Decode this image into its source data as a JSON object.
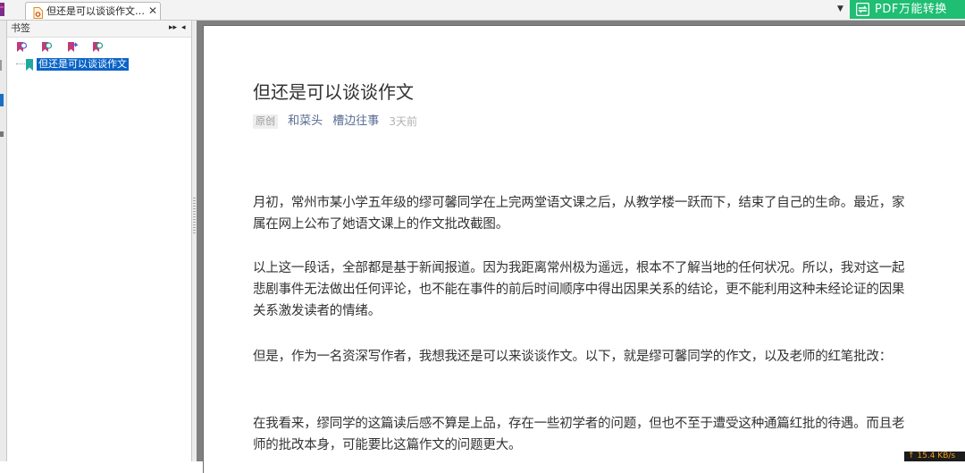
{
  "tab_bar": {
    "tab_title": "但还是可以谈谈作文....",
    "close_glyph": "✕",
    "dropdown_glyph": "▼",
    "pdf_button_label": "PDF万能转换",
    "pdf_button_color": "#1fbe73"
  },
  "bookmark_panel": {
    "title": "书签",
    "pin_glyph": "▸▸",
    "collapse_glyph": "◂",
    "toolbar_icons": [
      "add-bookmark-icon",
      "expand-bookmark-icon",
      "bookmark-forward-icon",
      "find-bookmark-icon"
    ],
    "item": {
      "label": "但还是可以谈谈作文",
      "icon": "bookmark-icon"
    }
  },
  "article": {
    "title": "但还是可以谈谈作文",
    "tag": "原创",
    "author": "和菜头",
    "account": "槽边往事",
    "time": "3天前",
    "paragraphs": [
      "月初，常州市某小学五年级的缪可馨同学在上完两堂语文课之后，从教学楼一跃而下，结束了自己的生命。最近，家属在网上公布了她语文课上的作文批改截图。",
      "以上这一段话，全部都是基于新闻报道。因为我距离常州极为遥远，根本不了解当地的任何状况。所以，我对这一起悲剧事件无法做出任何评论，也不能在事件的前后时间顺序中得出因果关系的结论，更不能利用这种未经论证的因果关系激发读者的情绪。",
      "但是，作为一名资深写作者，我想我还是可以来谈谈作文。以下，就是缪可馨同学的作文，以及老师的红笔批改：",
      "在我看来，缪同学的这篇读后感不算是上品，存在一些初学者的问题，但也不至于遭受这种通篇红批的待遇。而且老师的批改本身，可能要比这篇作文的问题更大。"
    ]
  },
  "status": {
    "speed": "↑ 15.4 KB/s"
  }
}
